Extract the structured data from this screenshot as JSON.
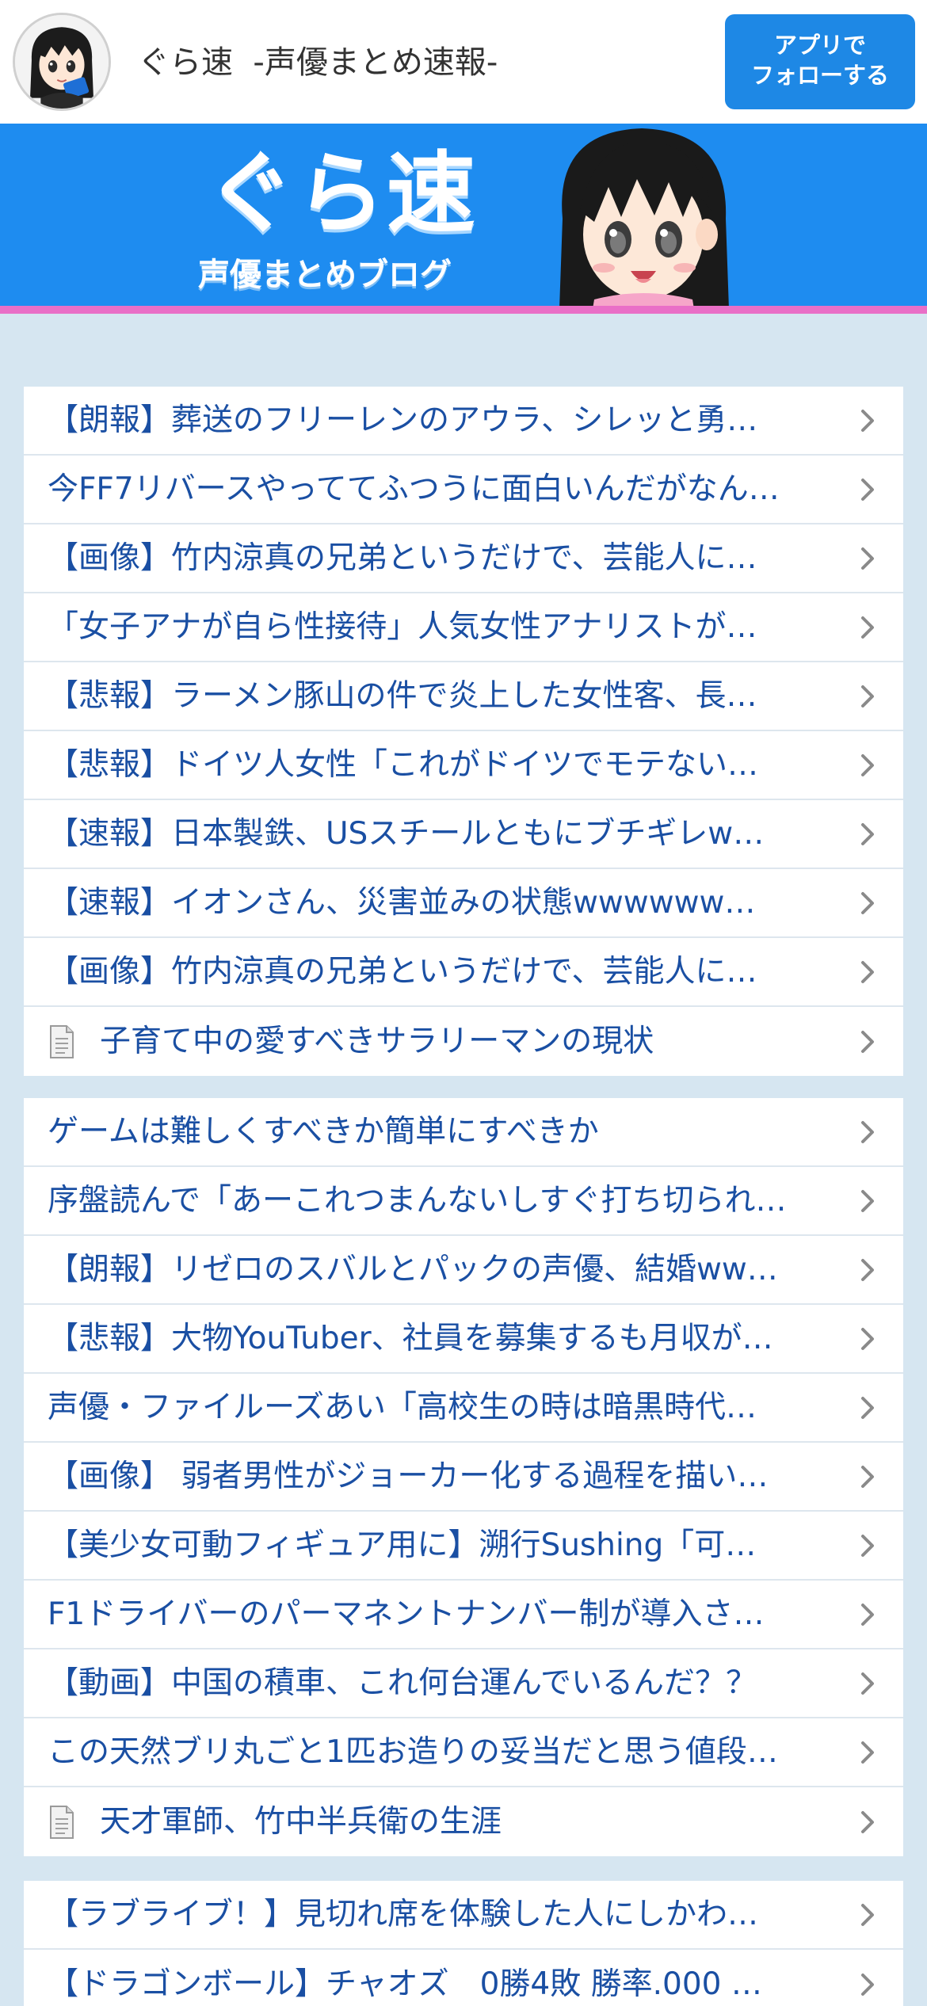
{
  "header": {
    "site_title": "ぐら速  -声優まとめ速報-",
    "follow_button": {
      "line1": "アプリで",
      "line2": "フォローする"
    }
  },
  "banner": {
    "logo_text": "ぐら速",
    "sub_text": "声優まとめブログ"
  },
  "colors": {
    "accent": "#1e88e5",
    "banner_bg": "#1e8cf0",
    "banner_stripe": "#e96fc7",
    "page_bg": "#d6e6f1",
    "link": "#1a4fa3"
  },
  "lists": [
    {
      "items": [
        {
          "text": "【朗報】葬送のフリーレンのアウラ、シレッと勇…",
          "icon": ""
        },
        {
          "text": "今FF7リバースやっててふつうに面白いんだがなん…",
          "icon": ""
        },
        {
          "text": "【画像】竹内涼真の兄弟というだけで、芸能人に…",
          "icon": ""
        },
        {
          "text": "「女子アナが自ら性接待」人気女性アナリストが…",
          "icon": ""
        },
        {
          "text": "【悲報】ラーメン豚山の件で炎上した女性客、長…",
          "icon": ""
        },
        {
          "text": "【悲報】ドイツ人女性「これがドイツでモテない…",
          "icon": ""
        },
        {
          "text": "【速報】日本製鉄、USスチールともにブチギレw…",
          "icon": ""
        },
        {
          "text": "【速報】イオンさん、災害並みの状態wwwwww…",
          "icon": ""
        },
        {
          "text": "【画像】竹内涼真の兄弟というだけで、芸能人に…",
          "icon": ""
        },
        {
          "text": "子育て中の愛すべきサラリーマンの現状",
          "icon": "document-icon"
        }
      ]
    },
    {
      "items": [
        {
          "text": "ゲームは難しくすべきか簡単にすべきか",
          "icon": ""
        },
        {
          "text": "序盤読んで「あーこれつまんないしすぐ打ち切られ…",
          "icon": ""
        },
        {
          "text": "【朗報】リゼロのスバルとパックの声優、結婚ww…",
          "icon": ""
        },
        {
          "text": "【悲報】大物YouTuber、社員を募集するも月収が…",
          "icon": ""
        },
        {
          "text": "声優・ファイルーズあい「高校生の時は暗黒時代…",
          "icon": ""
        },
        {
          "text": "【画像】 弱者男性がジョーカー化する過程を描い…",
          "icon": ""
        },
        {
          "text": "【美少女可動フィギュア用に】溯行Sushing「可…",
          "icon": ""
        },
        {
          "text": "F1ドライバーのパーマネントナンバー制が導入さ…",
          "icon": ""
        },
        {
          "text": "【動画】中国の積車、これ何台運んでいるんだ？？",
          "icon": ""
        },
        {
          "text": "この天然ブリ丸ごと1匹お造りの妥当だと思う値段…",
          "icon": ""
        },
        {
          "text": "天才軍師、竹中半兵衛の生涯",
          "icon": "document-icon"
        }
      ]
    },
    {
      "items": [
        {
          "text": "【ラブライブ！】見切れ席を体験した人にしかわ…",
          "icon": ""
        },
        {
          "text": "【ドラゴンボール】チャオズ　0勝4敗 勝率.000 …",
          "icon": ""
        }
      ]
    }
  ]
}
